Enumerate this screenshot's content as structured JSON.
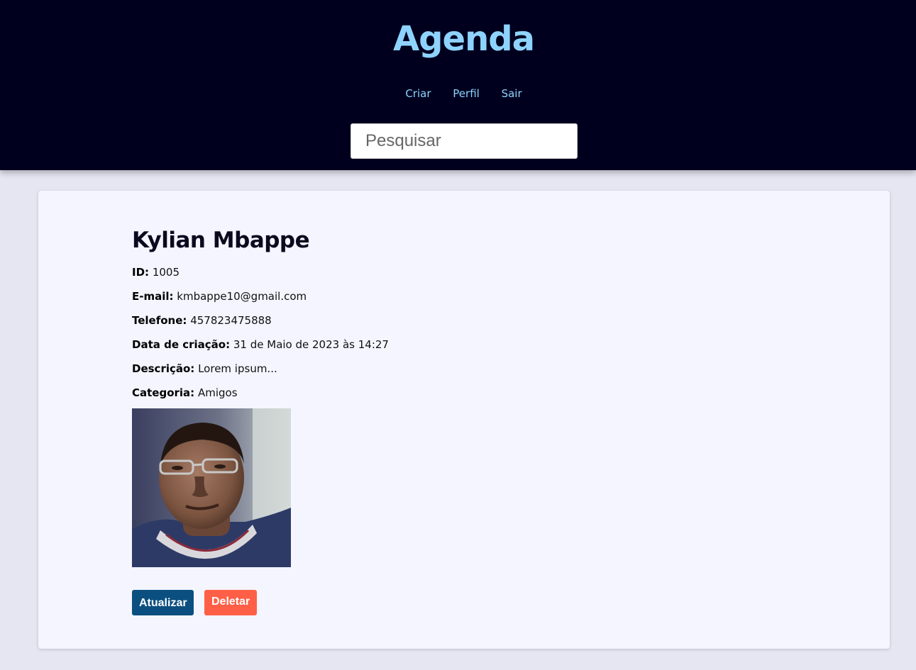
{
  "header": {
    "title": "Agenda",
    "nav": [
      "Criar",
      "Perfil",
      "Sair"
    ],
    "search_placeholder": "Pesquisar"
  },
  "contact": {
    "name": "Kylian Mbappe",
    "fields": {
      "id": {
        "label": "ID:",
        "value": "1005"
      },
      "email": {
        "label": "E-mail:",
        "value": "kmbappe10@gmail.com"
      },
      "phone": {
        "label": "Telefone:",
        "value": "457823475888"
      },
      "created": {
        "label": "Data de criação:",
        "value": "31 de Maio de 2023 às 14:27"
      },
      "description": {
        "label": "Descrição:",
        "value": "Lorem ipsum..."
      },
      "category": {
        "label": "Categoria:",
        "value": "Amigos"
      }
    },
    "photo_icon": "contact-photo"
  },
  "actions": {
    "update_label": "Atualizar",
    "delete_label": "Deletar"
  },
  "colors": {
    "header_bg": "#00001e",
    "accent": "#8ed3ff",
    "page_bg": "#e6e6f2",
    "card_bg": "#f4f5fe",
    "update_btn": "#0b4f80",
    "delete_btn": "#ff5f47"
  }
}
